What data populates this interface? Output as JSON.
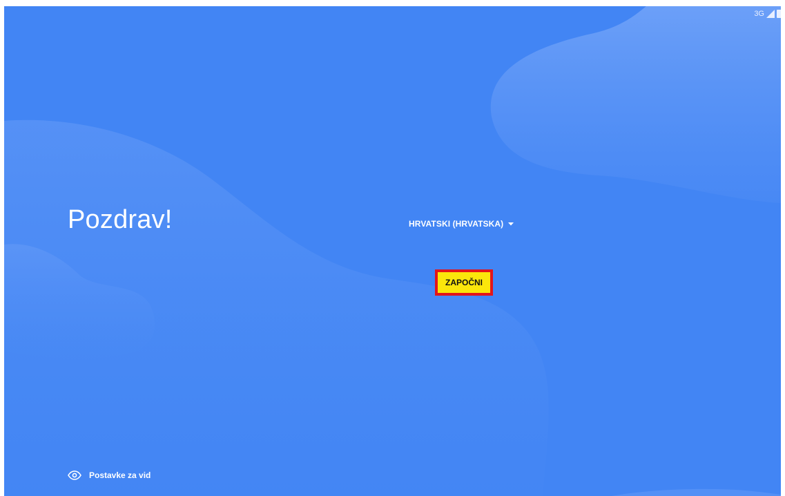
{
  "status_bar": {
    "network": "3G"
  },
  "welcome": {
    "greeting": "Pozdrav!",
    "language_label": "HRVATSKI (HRVATSKA)",
    "start_label": "ZAPOČNI"
  },
  "footer": {
    "vision_settings_label": "Postavke za vid"
  },
  "icons": {
    "signal": "signal-icon",
    "battery": "battery-icon",
    "dropdown": "dropdown-arrow-icon",
    "vision": "eye-icon"
  },
  "colors": {
    "background": "#4285f4",
    "highlight_fill": "#fbe60b",
    "highlight_border": "#e3151a"
  }
}
